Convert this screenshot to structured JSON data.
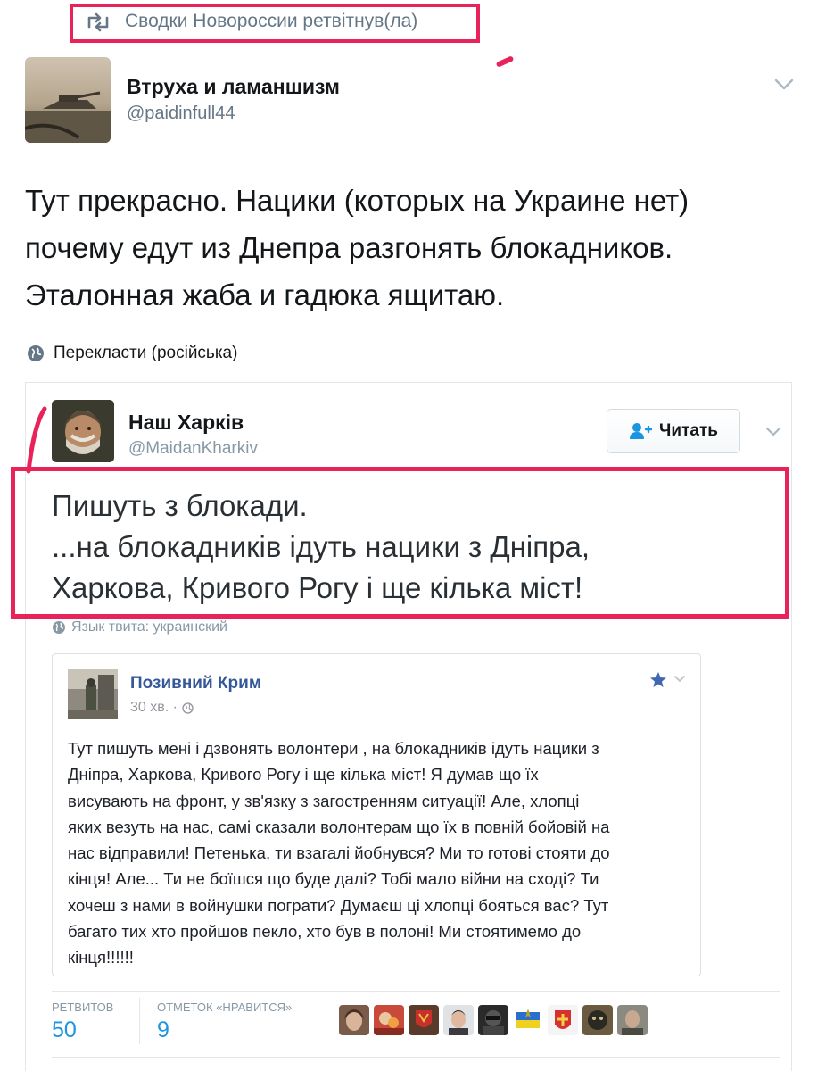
{
  "retweet_header": {
    "text": "Сводки Новороссии ретвітнув(ла)",
    "icon": "retweet-icon"
  },
  "author": {
    "name": "Втруха и ламаншизм",
    "handle": "@paidinfull44"
  },
  "tweet": {
    "text": "Тут прекрасно. Нацики (которых на Украине нет)\nпочему едут из Днепра разгонять блокадников.\nЭталонная жаба и гадюка ящитаю.",
    "translate": "Перекласти (російська)"
  },
  "quoted": {
    "author_name": "Наш Харків",
    "author_handle": "@MaidanKharkiv",
    "follow_label": "Читать",
    "text": "Пишуть з блокади.\n...на блокадників  ідуть нацики з Дніпра,\nХаркова, Кривого Рогу і ще кілька міст!",
    "lang": "Язык твита: украинский",
    "fb_post": {
      "author": "Позивний Крим",
      "time": "30 хв. ·",
      "text": "Тут пишуть мені і дзвонять волонтери , на блокадників ідуть нацики з\nДніпра, Харкова, Кривого Рогу і ще кілька міст! Я думав що їх\nвисувають на фронт, у зв'язку з загостренням ситуації! Але, хлопці\nяких везуть на нас, самі сказали волонтерам що їх в повній бойовій на\nнас відправили! Петенька, ти взагалі йобнувся? Ми то готові стояти до\nкінця! Але... Ти не боїшся що буде далі? Тобі мало війни на сході? Ти\nхочеш з нами в войнушки пограти? Думаєш ці хлопці бояться вас? Тут\nбагато тих хто пройшов пекло, хто був в полоні! Ми стоятимемо до\nкінця!!!!!!"
    },
    "stats": {
      "retweets_label": "РЕТВИТОВ",
      "retweets_count": "50",
      "likes_label": "ОТМЕТОК «НРАВИТСЯ»",
      "likes_count": "9",
      "liker_count": 9
    }
  },
  "colors": {
    "highlight": "#e8235a",
    "link_blue": "#1b95e0",
    "fb_blue": "#365899",
    "muted": "#657786"
  }
}
